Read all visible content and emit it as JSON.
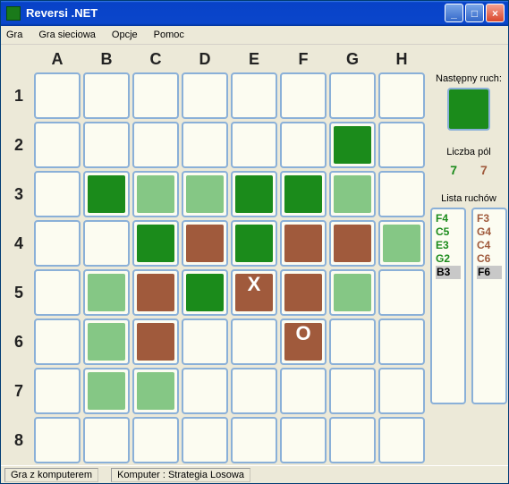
{
  "window": {
    "title": "Reversi .NET",
    "min_label": "_",
    "max_label": "□",
    "close_label": "×"
  },
  "menu": {
    "items": [
      "Gra",
      "Gra sieciowa",
      "Opcje",
      "Pomoc"
    ]
  },
  "board": {
    "cols": [
      "A",
      "B",
      "C",
      "D",
      "E",
      "F",
      "G",
      "H"
    ],
    "rows": [
      "1",
      "2",
      "3",
      "4",
      "5",
      "6",
      "7",
      "8"
    ],
    "cells": {
      "G2": "green",
      "B3": "green",
      "C3": "lgreen",
      "D3": "lgreen",
      "E3": "green",
      "F3": "green",
      "G3": "lgreen",
      "C4": "green",
      "D4": "brown",
      "E4": "green",
      "F4": "brown",
      "G4": "brown",
      "H4": "lgreen",
      "B5": "lgreen",
      "C5": "brown",
      "D5": "green",
      "E5": "brown",
      "F5": "brown",
      "G5": "lgreen",
      "B6": "lgreen",
      "C6": "brown",
      "F6": "brown",
      "B7": "lgreen",
      "C7": "lgreen"
    },
    "marks": {
      "E5": "X",
      "F6": "O"
    }
  },
  "side": {
    "next_label": "Następny ruch:",
    "next_color": "green",
    "count_label": "Liczba pól",
    "count_green": "7",
    "count_brown": "7",
    "moves_label": "Lista ruchów",
    "moves_green": [
      "F4",
      "C5",
      "E3",
      "G2",
      "B3"
    ],
    "moves_brown": [
      "F3",
      "G4",
      "C4",
      "C6",
      "F6"
    ],
    "sel_green": "B3",
    "sel_brown": "F6"
  },
  "status": {
    "seg1": "Gra z komputerem",
    "seg2": "Komputer : Strategia Losowa"
  },
  "chart_data": {
    "type": "table",
    "title": "Reversi board state 8x8",
    "columns": [
      "A",
      "B",
      "C",
      "D",
      "E",
      "F",
      "G",
      "H"
    ],
    "rows": [
      "1",
      "2",
      "3",
      "4",
      "5",
      "6",
      "7",
      "8"
    ],
    "cells": {
      "G2": "green",
      "B3": "green",
      "C3": "lgreen",
      "D3": "lgreen",
      "E3": "green",
      "F3": "green",
      "G3": "lgreen",
      "C4": "green",
      "D4": "brown",
      "E4": "green",
      "F4": "brown",
      "G4": "brown",
      "H4": "lgreen",
      "B5": "lgreen",
      "C5": "brown",
      "D5": "green",
      "E5": "brown",
      "F5": "brown",
      "G5": "lgreen",
      "B6": "lgreen",
      "C6": "brown",
      "F6": "brown",
      "B7": "lgreen",
      "C7": "lgreen"
    },
    "turn": "green",
    "score": {
      "green": 7,
      "brown": 7
    },
    "last_moves": {
      "green": "B3",
      "brown": "F6"
    },
    "marks": {
      "E5": "X",
      "F6": "O"
    }
  }
}
